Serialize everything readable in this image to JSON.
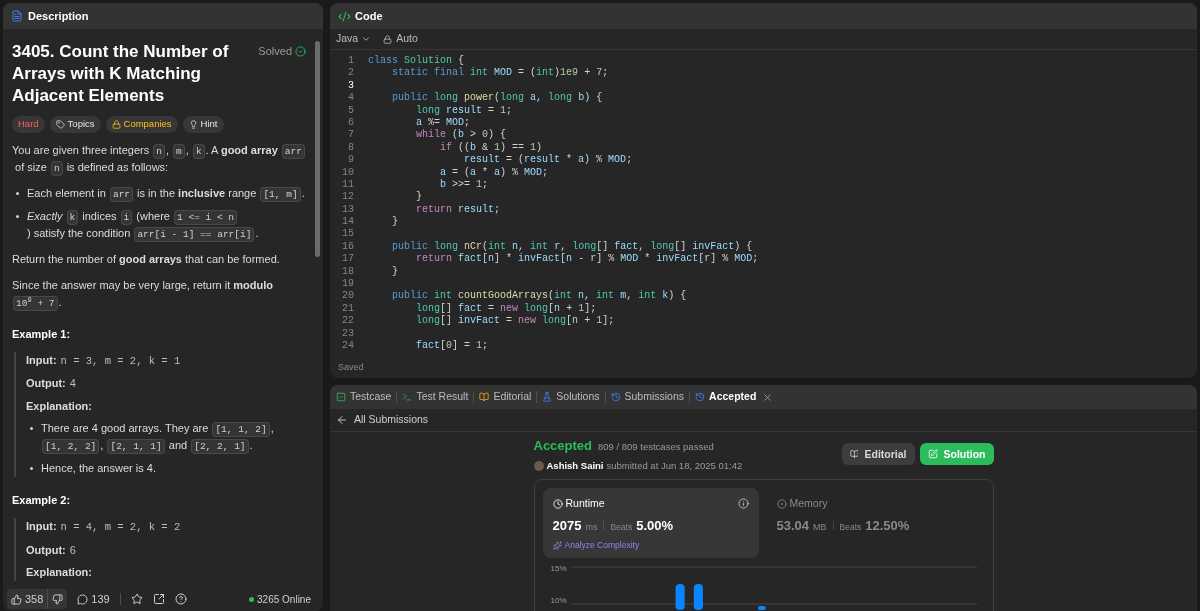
{
  "description": {
    "tab_title": "Description",
    "title": "3405. Count the Number of Arrays with K Matching Adjacent Elements",
    "status": "Solved",
    "tags": [
      {
        "kind": "difficulty",
        "label": "Hard"
      },
      {
        "kind": "topics",
        "label": "Topics"
      },
      {
        "kind": "companies",
        "label": "Companies"
      },
      {
        "kind": "hint",
        "label": "Hint"
      }
    ],
    "body": [
      {
        "kind": "paragraph",
        "parts": [
          {
            "kind": "text",
            "text": "You are given three integers "
          },
          {
            "kind": "code",
            "text": "n"
          },
          {
            "kind": "text",
            "text": ", "
          },
          {
            "kind": "code",
            "text": "m"
          },
          {
            "kind": "text",
            "text": ", "
          },
          {
            "kind": "code",
            "text": "k"
          },
          {
            "kind": "text",
            "text": ". A **good array** "
          },
          {
            "kind": "code",
            "text": "arr"
          },
          {
            "kind": "text",
            "text": " of size "
          },
          {
            "kind": "code",
            "text": "n"
          },
          {
            "kind": "text",
            "text": " is defined as follows:"
          }
        ]
      },
      {
        "kind": "bullets",
        "items": [
          [
            {
              "kind": "text",
              "text": "Each element in "
            },
            {
              "kind": "code",
              "text": "arr"
            },
            {
              "kind": "text",
              "text": " is in the **inclusive** range "
            },
            {
              "kind": "code",
              "text": "[1, m]"
            },
            {
              "kind": "text",
              "text": "."
            }
          ],
          [
            {
              "kind": "text",
              "text": "*Exactly* "
            },
            {
              "kind": "code",
              "text": "k"
            },
            {
              "kind": "text",
              "text": " indices "
            },
            {
              "kind": "code",
              "text": "i"
            },
            {
              "kind": "text",
              "text": " (where "
            },
            {
              "kind": "code",
              "text": "1 <= i < n"
            },
            {
              "kind": "text",
              "text": ") satisfy the condition "
            },
            {
              "kind": "code",
              "text": "arr[i - 1] == arr[i]"
            },
            {
              "kind": "text",
              "text": "."
            }
          ]
        ]
      },
      {
        "kind": "paragraph",
        "parts": [
          {
            "kind": "text",
            "text": "Return the number of **good arrays** that can be formed."
          }
        ]
      },
      {
        "kind": "paragraph",
        "parts": [
          {
            "kind": "text",
            "text": "Since the answer may be very large, return it **modulo** "
          },
          {
            "kind": "code",
            "text": "10$^{9}$ + 7"
          },
          {
            "kind": "text",
            "text": "."
          }
        ]
      },
      {
        "kind": "heading",
        "text": "Example 1:"
      },
      {
        "kind": "example",
        "lines": [
          {
            "label": "Input:",
            "value": "n = 3, m = 2, k = 1",
            "mono": true
          },
          {
            "label": "Output:",
            "value": "4",
            "mono": false
          },
          {
            "label": "Explanation:"
          }
        ],
        "bullets": [
          [
            {
              "kind": "text",
              "text": "There are 4 good arrays. They are "
            },
            {
              "kind": "code",
              "text": "[1, 1, 2]"
            },
            {
              "kind": "text",
              "text": ", "
            },
            {
              "kind": "code",
              "text": "[1, 2, 2]"
            },
            {
              "kind": "text",
              "text": ", "
            },
            {
              "kind": "code",
              "text": "[2, 1, 1]"
            },
            {
              "kind": "text",
              "text": " and "
            },
            {
              "kind": "code",
              "text": "[2, 2, 1]"
            },
            {
              "kind": "text",
              "text": "."
            }
          ],
          [
            {
              "kind": "text",
              "text": "Hence, the answer is 4."
            }
          ]
        ]
      },
      {
        "kind": "heading",
        "text": "Example 2:"
      },
      {
        "kind": "example",
        "lines": [
          {
            "label": "Input:",
            "value": "n = 4, m = 2, k = 2",
            "mono": true
          },
          {
            "label": "Output:",
            "value": "6",
            "mono": false
          },
          {
            "label": "Explanation:"
          }
        ]
      }
    ],
    "footer": {
      "likes": "358",
      "comments": "139",
      "online": "3265 Online"
    }
  },
  "code": {
    "title": "Code",
    "language": "Java",
    "mode": "Auto",
    "status": "Saved",
    "lines": [
      {
        "no": "1",
        "current": false,
        "tokens": [
          {
            "kind": "k",
            "text": "class "
          },
          {
            "kind": "t",
            "text": "Solution"
          },
          {
            "kind": "p",
            "text": " {"
          }
        ]
      },
      {
        "no": "2",
        "current": false,
        "tokens": [
          {
            "kind": "k",
            "text": "    static final "
          },
          {
            "kind": "t",
            "text": "int "
          },
          {
            "kind": "v",
            "text": "MOD"
          },
          {
            "kind": "p",
            "text": " = ("
          },
          {
            "kind": "t",
            "text": "int"
          },
          {
            "kind": "p",
            "text": ")"
          },
          {
            "kind": "n",
            "text": "1e9"
          },
          {
            "kind": "p",
            "text": " + "
          },
          {
            "kind": "n",
            "text": "7"
          },
          {
            "kind": "p",
            "text": ";"
          }
        ]
      },
      {
        "no": "3",
        "current": true
      },
      {
        "no": "4",
        "current": false,
        "tokens": [
          {
            "kind": "k",
            "text": "    public "
          },
          {
            "kind": "t",
            "text": "long "
          },
          {
            "kind": "f",
            "text": "power"
          },
          {
            "kind": "p",
            "text": "("
          },
          {
            "kind": "t",
            "text": "long "
          },
          {
            "kind": "v",
            "text": "a"
          },
          {
            "kind": "p",
            "text": ", "
          },
          {
            "kind": "t",
            "text": "long "
          },
          {
            "kind": "v",
            "text": "b"
          },
          {
            "kind": "p",
            "text": ") {"
          }
        ]
      },
      {
        "no": "5",
        "current": false,
        "tokens": [
          {
            "kind": "t",
            "text": "        long "
          },
          {
            "kind": "v",
            "text": "result"
          },
          {
            "kind": "p",
            "text": " = "
          },
          {
            "kind": "n",
            "text": "1"
          },
          {
            "kind": "p",
            "text": ";"
          }
        ]
      },
      {
        "no": "6",
        "current": false,
        "tokens": [
          {
            "kind": "v",
            "text": "        a"
          },
          {
            "kind": "p",
            "text": " %= "
          },
          {
            "kind": "v",
            "text": "MOD"
          },
          {
            "kind": "p",
            "text": ";"
          }
        ]
      },
      {
        "no": "7",
        "current": false,
        "tokens": [
          {
            "kind": "c",
            "text": "        while"
          },
          {
            "kind": "p",
            "text": " ("
          },
          {
            "kind": "v",
            "text": "b"
          },
          {
            "kind": "p",
            "text": " > "
          },
          {
            "kind": "n",
            "text": "0"
          },
          {
            "kind": "p",
            "text": ") {"
          }
        ]
      },
      {
        "no": "8",
        "current": false,
        "tokens": [
          {
            "kind": "c",
            "text": "            if"
          },
          {
            "kind": "p",
            "text": " (("
          },
          {
            "kind": "v",
            "text": "b"
          },
          {
            "kind": "p",
            "text": " & "
          },
          {
            "kind": "n",
            "text": "1"
          },
          {
            "kind": "p",
            "text": ") == "
          },
          {
            "kind": "n",
            "text": "1"
          },
          {
            "kind": "p",
            "text": ")"
          }
        ]
      },
      {
        "no": "9",
        "current": false,
        "tokens": [
          {
            "kind": "v",
            "text": "                result"
          },
          {
            "kind": "p",
            "text": " = ("
          },
          {
            "kind": "v",
            "text": "result"
          },
          {
            "kind": "p",
            "text": " * "
          },
          {
            "kind": "v",
            "text": "a"
          },
          {
            "kind": "p",
            "text": ") % "
          },
          {
            "kind": "v",
            "text": "MOD"
          },
          {
            "kind": "p",
            "text": ";"
          }
        ]
      },
      {
        "no": "10",
        "current": false,
        "tokens": [
          {
            "kind": "v",
            "text": "            a"
          },
          {
            "kind": "p",
            "text": " = ("
          },
          {
            "kind": "v",
            "text": "a"
          },
          {
            "kind": "p",
            "text": " * "
          },
          {
            "kind": "v",
            "text": "a"
          },
          {
            "kind": "p",
            "text": ") % "
          },
          {
            "kind": "v",
            "text": "MOD"
          },
          {
            "kind": "p",
            "text": ";"
          }
        ]
      },
      {
        "no": "11",
        "current": false,
        "tokens": [
          {
            "kind": "v",
            "text": "            b"
          },
          {
            "kind": "p",
            "text": " >>= "
          },
          {
            "kind": "n",
            "text": "1"
          },
          {
            "kind": "p",
            "text": ";"
          }
        ]
      },
      {
        "no": "12",
        "current": false,
        "tokens": [
          {
            "kind": "p",
            "text": "        }"
          }
        ]
      },
      {
        "no": "13",
        "current": false,
        "tokens": [
          {
            "kind": "c",
            "text": "        return "
          },
          {
            "kind": "v",
            "text": "result"
          },
          {
            "kind": "p",
            "text": ";"
          }
        ]
      },
      {
        "no": "14",
        "current": false,
        "tokens": [
          {
            "kind": "p",
            "text": "    }"
          }
        ]
      },
      {
        "no": "15",
        "current": false
      },
      {
        "no": "16",
        "current": false,
        "tokens": [
          {
            "kind": "k",
            "text": "    public "
          },
          {
            "kind": "t",
            "text": "long "
          },
          {
            "kind": "f",
            "text": "nCr"
          },
          {
            "kind": "p",
            "text": "("
          },
          {
            "kind": "t",
            "text": "int "
          },
          {
            "kind": "v",
            "text": "n"
          },
          {
            "kind": "p",
            "text": ", "
          },
          {
            "kind": "t",
            "text": "int "
          },
          {
            "kind": "v",
            "text": "r"
          },
          {
            "kind": "p",
            "text": ", "
          },
          {
            "kind": "t",
            "text": "long"
          },
          {
            "kind": "p",
            "text": "[] "
          },
          {
            "kind": "v",
            "text": "fact"
          },
          {
            "kind": "p",
            "text": ", "
          },
          {
            "kind": "t",
            "text": "long"
          },
          {
            "kind": "p",
            "text": "[] "
          },
          {
            "kind": "v",
            "text": "invFact"
          },
          {
            "kind": "p",
            "text": ") {"
          }
        ]
      },
      {
        "no": "17",
        "current": false,
        "tokens": [
          {
            "kind": "c",
            "text": "        return "
          },
          {
            "kind": "v",
            "text": "fact"
          },
          {
            "kind": "p",
            "text": "["
          },
          {
            "kind": "v",
            "text": "n"
          },
          {
            "kind": "p",
            "text": "] * "
          },
          {
            "kind": "v",
            "text": "invFact"
          },
          {
            "kind": "p",
            "text": "["
          },
          {
            "kind": "v",
            "text": "n"
          },
          {
            "kind": "p",
            "text": " - "
          },
          {
            "kind": "v",
            "text": "r"
          },
          {
            "kind": "p",
            "text": "] % "
          },
          {
            "kind": "v",
            "text": "MOD"
          },
          {
            "kind": "p",
            "text": " * "
          },
          {
            "kind": "v",
            "text": "invFact"
          },
          {
            "kind": "p",
            "text": "["
          },
          {
            "kind": "v",
            "text": "r"
          },
          {
            "kind": "p",
            "text": "] % "
          },
          {
            "kind": "v",
            "text": "MOD"
          },
          {
            "kind": "p",
            "text": ";"
          }
        ]
      },
      {
        "no": "18",
        "current": false,
        "tokens": [
          {
            "kind": "p",
            "text": "    }"
          }
        ]
      },
      {
        "no": "19",
        "current": false
      },
      {
        "no": "20",
        "current": false,
        "tokens": [
          {
            "kind": "k",
            "text": "    public "
          },
          {
            "kind": "t",
            "text": "int "
          },
          {
            "kind": "f",
            "text": "countGoodArrays"
          },
          {
            "kind": "p",
            "text": "("
          },
          {
            "kind": "t",
            "text": "int "
          },
          {
            "kind": "v",
            "text": "n"
          },
          {
            "kind": "p",
            "text": ", "
          },
          {
            "kind": "t",
            "text": "int "
          },
          {
            "kind": "v",
            "text": "m"
          },
          {
            "kind": "p",
            "text": ", "
          },
          {
            "kind": "t",
            "text": "int "
          },
          {
            "kind": "v",
            "text": "k"
          },
          {
            "kind": "p",
            "text": ") {"
          }
        ]
      },
      {
        "no": "21",
        "current": false,
        "tokens": [
          {
            "kind": "t",
            "text": "        long"
          },
          {
            "kind": "p",
            "text": "[] "
          },
          {
            "kind": "v",
            "text": "fact"
          },
          {
            "kind": "p",
            "text": " = "
          },
          {
            "kind": "c",
            "text": "new "
          },
          {
            "kind": "t",
            "text": "long"
          },
          {
            "kind": "p",
            "text": "["
          },
          {
            "kind": "v",
            "text": "n"
          },
          {
            "kind": "p",
            "text": " + "
          },
          {
            "kind": "n",
            "text": "1"
          },
          {
            "kind": "p",
            "text": "];"
          }
        ]
      },
      {
        "no": "22",
        "current": false,
        "tokens": [
          {
            "kind": "t",
            "text": "        long"
          },
          {
            "kind": "p",
            "text": "[] "
          },
          {
            "kind": "v",
            "text": "invFact"
          },
          {
            "kind": "p",
            "text": " = "
          },
          {
            "kind": "c",
            "text": "new "
          },
          {
            "kind": "t",
            "text": "long"
          },
          {
            "kind": "p",
            "text": "["
          },
          {
            "kind": "v",
            "text": "n"
          },
          {
            "kind": "p",
            "text": " + "
          },
          {
            "kind": "n",
            "text": "1"
          },
          {
            "kind": "p",
            "text": "];"
          }
        ]
      },
      {
        "no": "23",
        "current": false
      },
      {
        "no": "24",
        "current": false,
        "tokens": [
          {
            "kind": "v",
            "text": "        fact"
          },
          {
            "kind": "p",
            "text": "["
          },
          {
            "kind": "n",
            "text": "0"
          },
          {
            "kind": "p",
            "text": "] = "
          },
          {
            "kind": "n",
            "text": "1"
          },
          {
            "kind": "p",
            "text": ";"
          }
        ]
      }
    ]
  },
  "results": {
    "tabs": [
      {
        "kind": "testcase",
        "label": "Testcase",
        "selected": false,
        "closable": false
      },
      {
        "kind": "result",
        "label": "Test Result",
        "selected": false,
        "closable": false
      },
      {
        "kind": "editorial",
        "label": "Editorial",
        "selected": false,
        "closable": false
      },
      {
        "kind": "solutions",
        "label": "Solutions",
        "selected": false,
        "closable": false
      },
      {
        "kind": "submissions",
        "label": "Submissions",
        "selected": false,
        "closable": false
      },
      {
        "kind": "submissions",
        "label": "Accepted",
        "selected": true,
        "closable": true
      }
    ],
    "back_label": "All Submissions",
    "submission": {
      "status": "Accepted",
      "testcases": "809 / 809 testcases passed",
      "author": "Ashish Saini",
      "submitted": "submitted at Jun 18, 2025 01:42",
      "buttons": [
        {
          "kind": "secondary",
          "label": "Editorial"
        },
        {
          "kind": "primary",
          "label": "Solution"
        }
      ],
      "metrics": [
        {
          "kind": "runtime",
          "label": "Runtime",
          "value": "2075",
          "unit": "ms",
          "beats_label": "Beats",
          "beats": "5.00%",
          "selected": true,
          "action": "Analyze Complexity"
        },
        {
          "kind": "memory",
          "label": "Memory",
          "value": "53.04",
          "unit": "MB",
          "beats_label": "Beats",
          "beats": "12.50%",
          "selected": false
        }
      ],
      "chart_ticks": [
        "15%",
        "10%"
      ]
    }
  }
}
